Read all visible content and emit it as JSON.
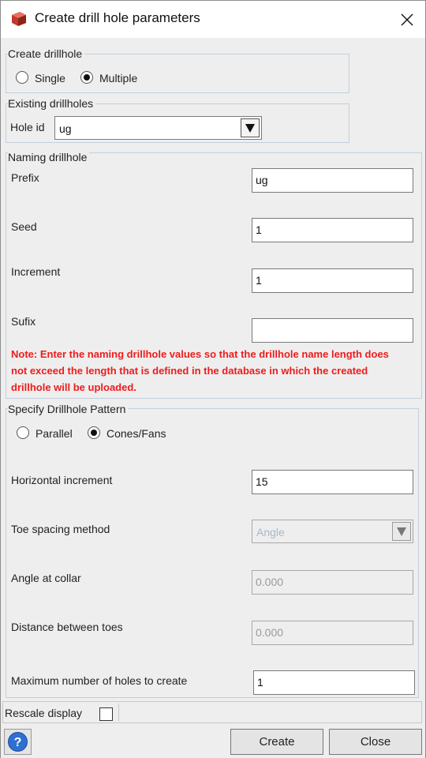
{
  "window": {
    "title": "Create drill hole parameters"
  },
  "create_drillhole": {
    "title": "Create drillhole",
    "options": [
      "Single",
      "Multiple"
    ],
    "selected": "Multiple"
  },
  "existing_drillholes": {
    "title": "Existing drillholes",
    "hole_id_label": "Hole id",
    "hole_id_value": "ug"
  },
  "naming": {
    "title": "Naming drillhole",
    "prefix_label": "Prefix",
    "prefix_value": "ug",
    "seed_label": "Seed",
    "seed_value": "1",
    "increment_label": "Increment",
    "increment_value": "1",
    "sufix_label": "Sufix",
    "sufix_value": "",
    "note": "Note: Enter the naming drillhole values so that the drillhole name length does not exceed the length that is defined in the database in which the created drillhole will be uploaded."
  },
  "pattern": {
    "title": "Specify Drillhole Pattern",
    "options": [
      "Parallel",
      "Cones/Fans"
    ],
    "selected": "Cones/Fans",
    "horizontal_increment_label": "Horizontal increment",
    "horizontal_increment_value": "15",
    "toe_spacing_label": "Toe spacing method",
    "toe_spacing_value": "Angle",
    "angle_at_collar_label": "Angle at collar",
    "angle_at_collar_value": "0.000",
    "distance_between_toes_label": "Distance between toes",
    "distance_between_toes_value": "0.000",
    "max_holes_label": "Maximum number of holes to create",
    "max_holes_value": "1"
  },
  "footer": {
    "rescale_label": "Rescale display",
    "rescale_checked": false,
    "create_label": "Create",
    "close_label": "Close"
  },
  "icons": {
    "app": "drill-app-icon",
    "close": "close-icon",
    "help": "help-icon",
    "dropdown": "dropdown-arrow-icon"
  },
  "colors": {
    "note_red": "#ee1c1c",
    "group_border": "#c3cfdc",
    "help_blue": "#2f6fd1"
  }
}
